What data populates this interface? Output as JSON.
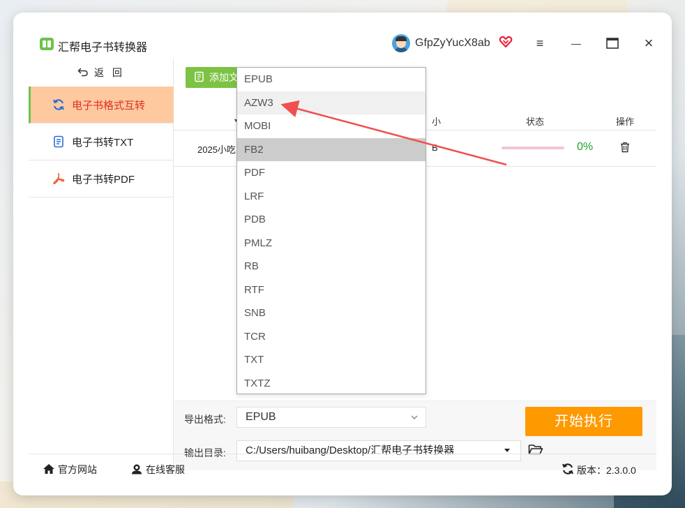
{
  "app": {
    "title": "汇帮电子书转换器",
    "username": "GfpZyYucX8ab"
  },
  "titlebar": {
    "menu_glyph": "≡",
    "minimize_glyph": "—",
    "maximize_glyph": "🗖",
    "close_glyph": "×"
  },
  "sidebar": {
    "back_label": "返 回",
    "items": [
      {
        "label": "电子书格式互转",
        "active": true
      },
      {
        "label": "电子书转TXT"
      },
      {
        "label": "电子书转PDF"
      }
    ]
  },
  "main": {
    "add_label": "添加文",
    "columns": {
      "size": "小",
      "status": "状态",
      "action": "操作"
    },
    "rows": [
      {
        "name": "2025小吃",
        "size": "B",
        "progress_pct": 0,
        "progress_label": "0%"
      }
    ]
  },
  "export": {
    "format_label": "导出格式:",
    "format_value": "EPUB",
    "dir_label": "输出目录:",
    "dir_value": "C:/Users/huibang/Desktop/汇帮电子书转换器",
    "start_label": "开始执行"
  },
  "dropdown": {
    "options": [
      "EPUB",
      "AZW3",
      "MOBI",
      "FB2",
      "PDF",
      "LRF",
      "PDB",
      "PMLZ",
      "RB",
      "RTF",
      "SNB",
      "TCR",
      "TXT",
      "TXTZ"
    ],
    "hover_index": 1,
    "selected_index": 3
  },
  "footer": {
    "website": "官方网站",
    "support": "在线客服",
    "version": "版本：2.3.0.0"
  },
  "colors": {
    "accent_orange": "#ff9900",
    "active_bg": "#ffc9a0",
    "active_text": "#e0301e",
    "green": "#7cc243",
    "arrow_red": "#f05050"
  },
  "icons": [
    "app-logo-icon",
    "avatar-icon",
    "vip-heart-icon",
    "menu-icon",
    "minimize-icon",
    "maximize-icon",
    "close-icon",
    "back-icon",
    "convert-icon",
    "txt-file-icon",
    "pdf-icon",
    "add-file-icon",
    "sort-arrow-icon",
    "trash-icon",
    "folder-icon",
    "home-icon",
    "support-icon",
    "refresh-icon",
    "chevron-down-icon",
    "caret-down-icon"
  ]
}
